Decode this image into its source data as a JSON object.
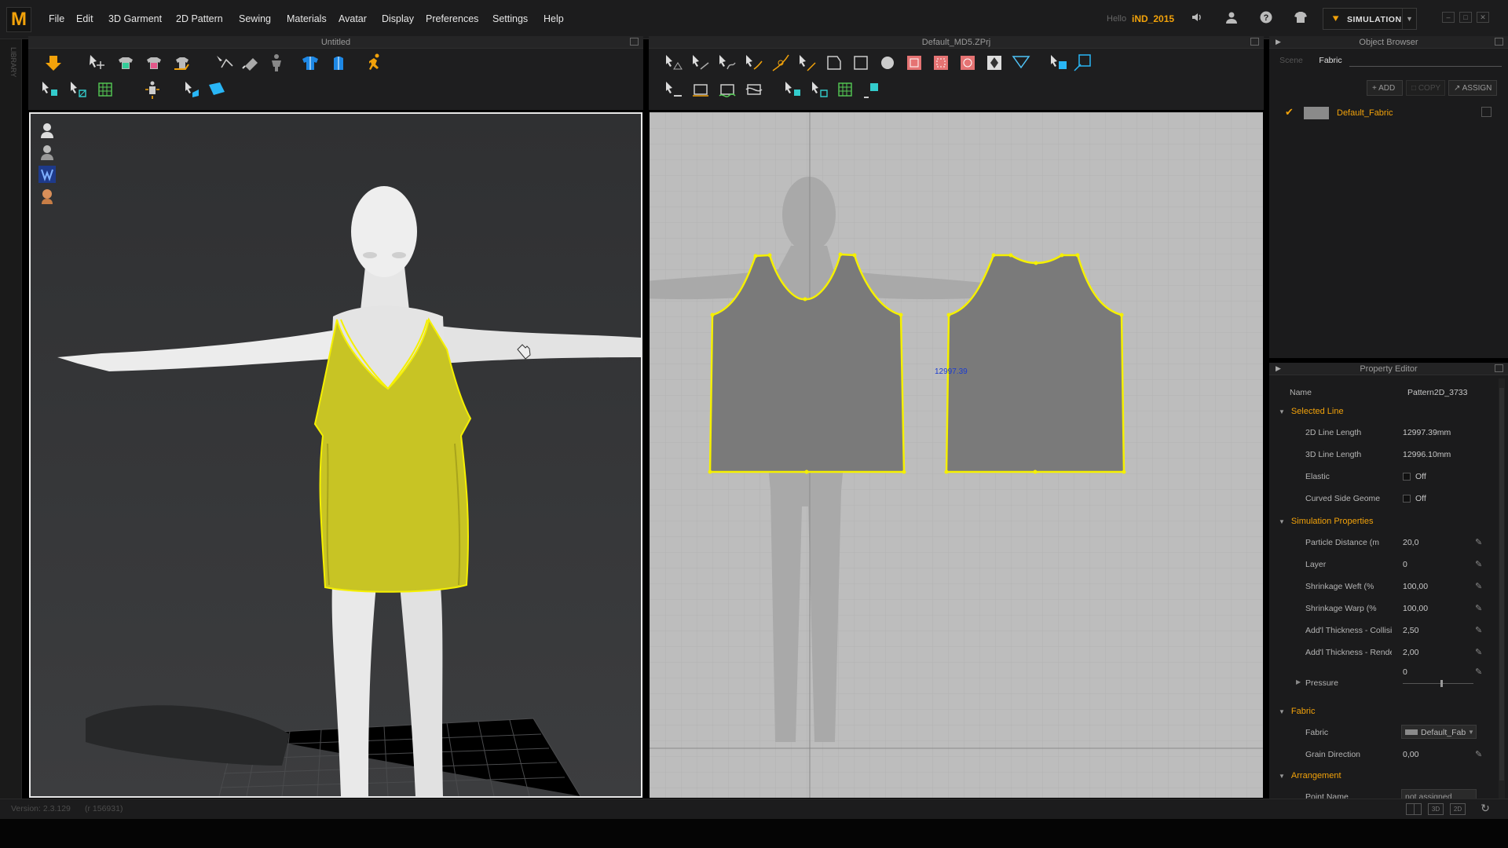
{
  "app": {
    "logo": "M",
    "menu": [
      "File",
      "Edit",
      "3D Garment",
      "2D Pattern",
      "Sewing",
      "Materials",
      "Avatar",
      "Display",
      "Preferences",
      "Settings",
      "Help"
    ],
    "hello": "Hello",
    "username": "iND_2015",
    "mode_button": "SIMULATION",
    "library_label": "LIBRARY"
  },
  "panels": {
    "view3d_title": "Untitled",
    "view2d_title": "Default_MD5.ZPrj",
    "object_browser_title": "Object Browser",
    "property_editor_title": "Property Editor"
  },
  "view2d": {
    "measure_label": "12997.39"
  },
  "object_browser": {
    "tabs": [
      "Scene",
      "Fabric"
    ],
    "active_tab": "Fabric",
    "buttons": {
      "add": "ADD",
      "copy": "COPY",
      "assign": "ASSIGN"
    },
    "fabric_item": "Default_Fabric"
  },
  "property_editor": {
    "name_label": "Name",
    "name_value": "Pattern2D_3733",
    "sections": {
      "selected_line": "Selected Line",
      "simulation": "Simulation Properties",
      "fabric": "Fabric",
      "arrangement": "Arrangement"
    },
    "selected_line": [
      {
        "key": "2D Line Length",
        "value": "12997.39mm"
      },
      {
        "key": "3D Line Length",
        "value": "12996.10mm"
      },
      {
        "key": "Elastic",
        "value": "Off"
      },
      {
        "key": "Curved Side Geome",
        "value": "Off"
      }
    ],
    "simulation": [
      {
        "key": "Particle Distance (m",
        "value": "20,0"
      },
      {
        "key": "Layer",
        "value": "0"
      },
      {
        "key": "Shrinkage Weft (%",
        "value": "100,00"
      },
      {
        "key": "Shrinkage Warp (%",
        "value": "100,00"
      },
      {
        "key": "Add'l Thickness - Collisio",
        "value": "2,50"
      },
      {
        "key": "Add'l Thickness - Renderi",
        "value": "2,00"
      }
    ],
    "pressure": {
      "key": "Pressure",
      "value": "0"
    },
    "fabric": [
      {
        "key": "Fabric",
        "value": "Default_Fab"
      },
      {
        "key": "Grain Direction",
        "value": "0,00"
      }
    ],
    "arrangement": [
      {
        "key": "Point Name",
        "value": "not assigned"
      }
    ]
  },
  "status": {
    "version": "Version: 2.3.129",
    "revision": "(r 156931)"
  },
  "colors": {
    "accent": "#f2a20a",
    "garment": "#c8c424",
    "pattern_outline": "#f5f000",
    "pattern_fill": "#7a7a7a"
  }
}
